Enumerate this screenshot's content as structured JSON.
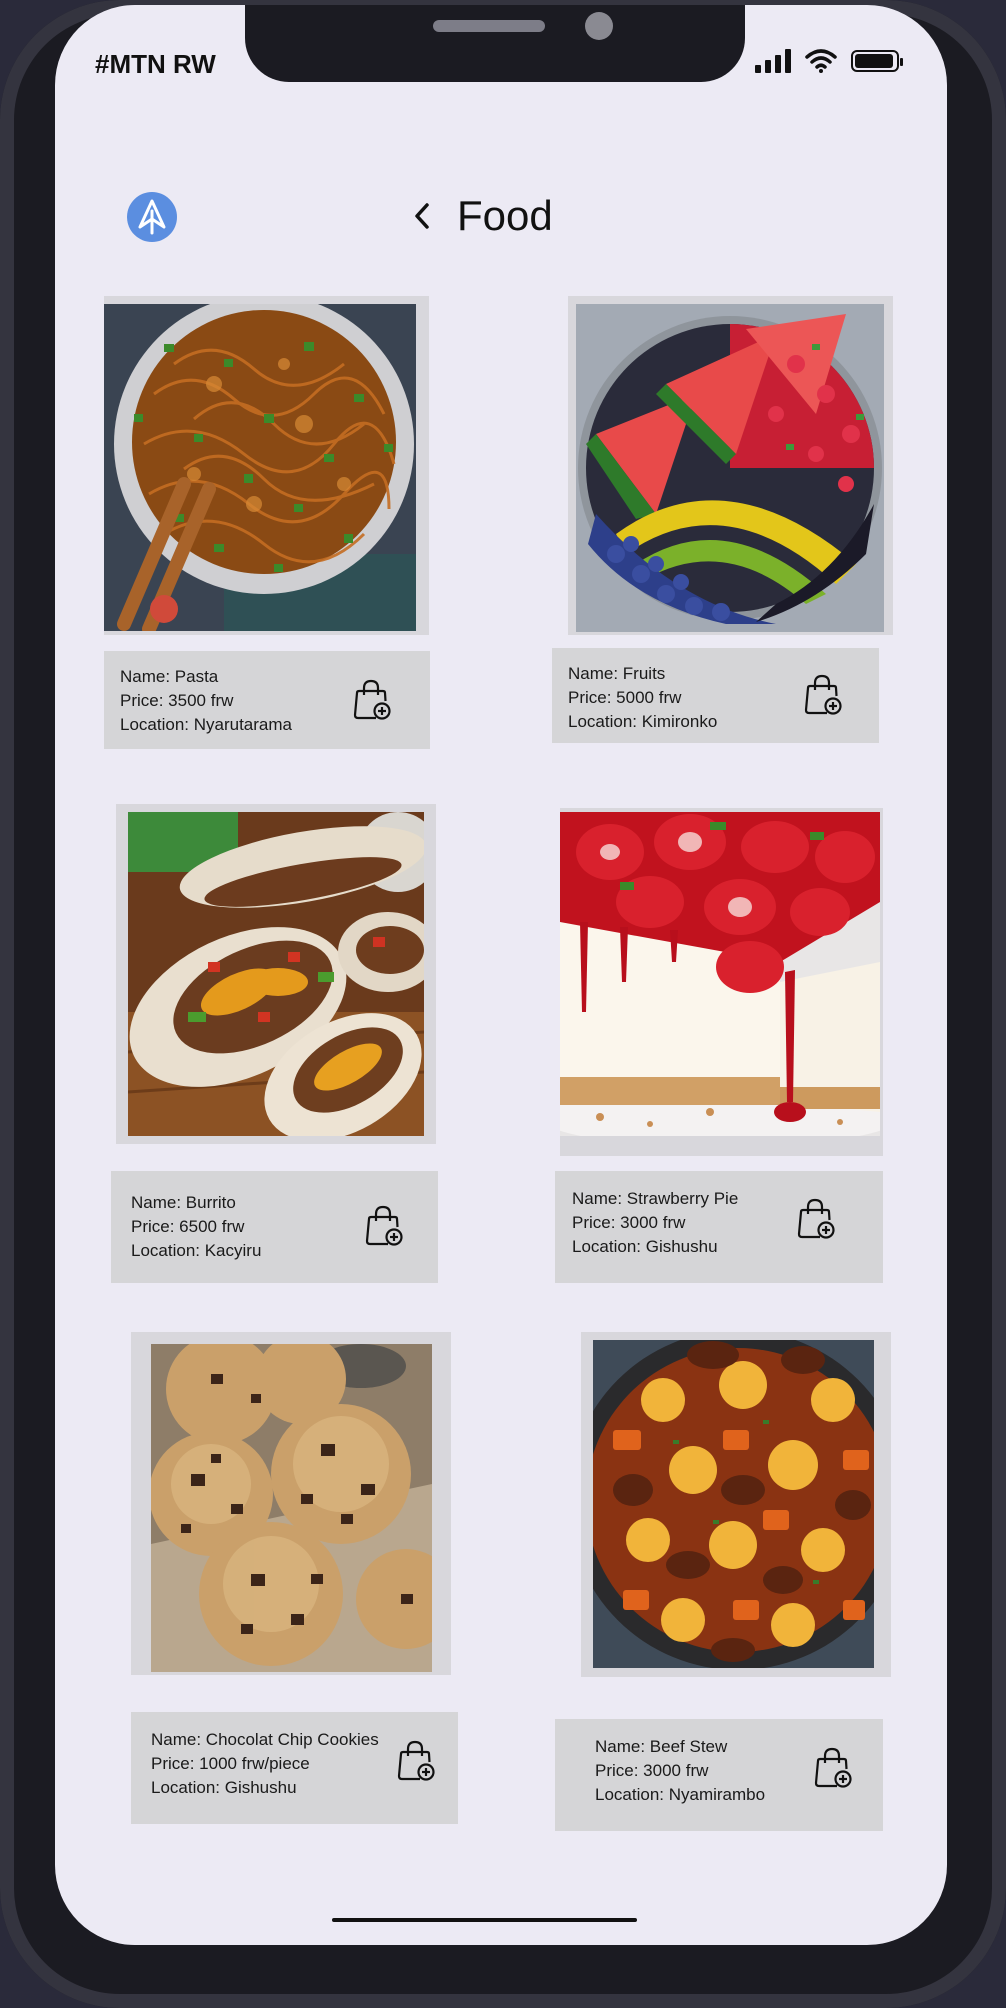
{
  "status_bar": {
    "carrier": "#MTN RW"
  },
  "header": {
    "title": "Food",
    "upload_icon": "arrow-up-icon",
    "back_icon": "chevron-left-icon"
  },
  "items": [
    {
      "name": "Name: Pasta",
      "price": "Price: 3500 frw",
      "location": "Location: Nyarutarama"
    },
    {
      "name": "Name: Fruits",
      "price": "Price: 5000 frw",
      "location": "Location: Kimironko"
    },
    {
      "name": "Name: Burrito",
      "price": "Price: 6500 frw",
      "location": "Location: Kacyiru"
    },
    {
      "name": "Name: Strawberry Pie",
      "price": "Price: 3000 frw",
      "location": "Location: Gishushu"
    },
    {
      "name": "Name: Chocolat Chip Cookies",
      "price": "Price: 1000 frw/piece",
      "location": "Location: Gishushu"
    },
    {
      "name": "Name: Beef Stew",
      "price": "Price: 3000 frw",
      "location": "Location: Nyamirambo"
    }
  ],
  "colors": {
    "accent": "#5b8ee0",
    "screen_bg": "#eceaf4",
    "card_bg": "#d5d5d7"
  }
}
